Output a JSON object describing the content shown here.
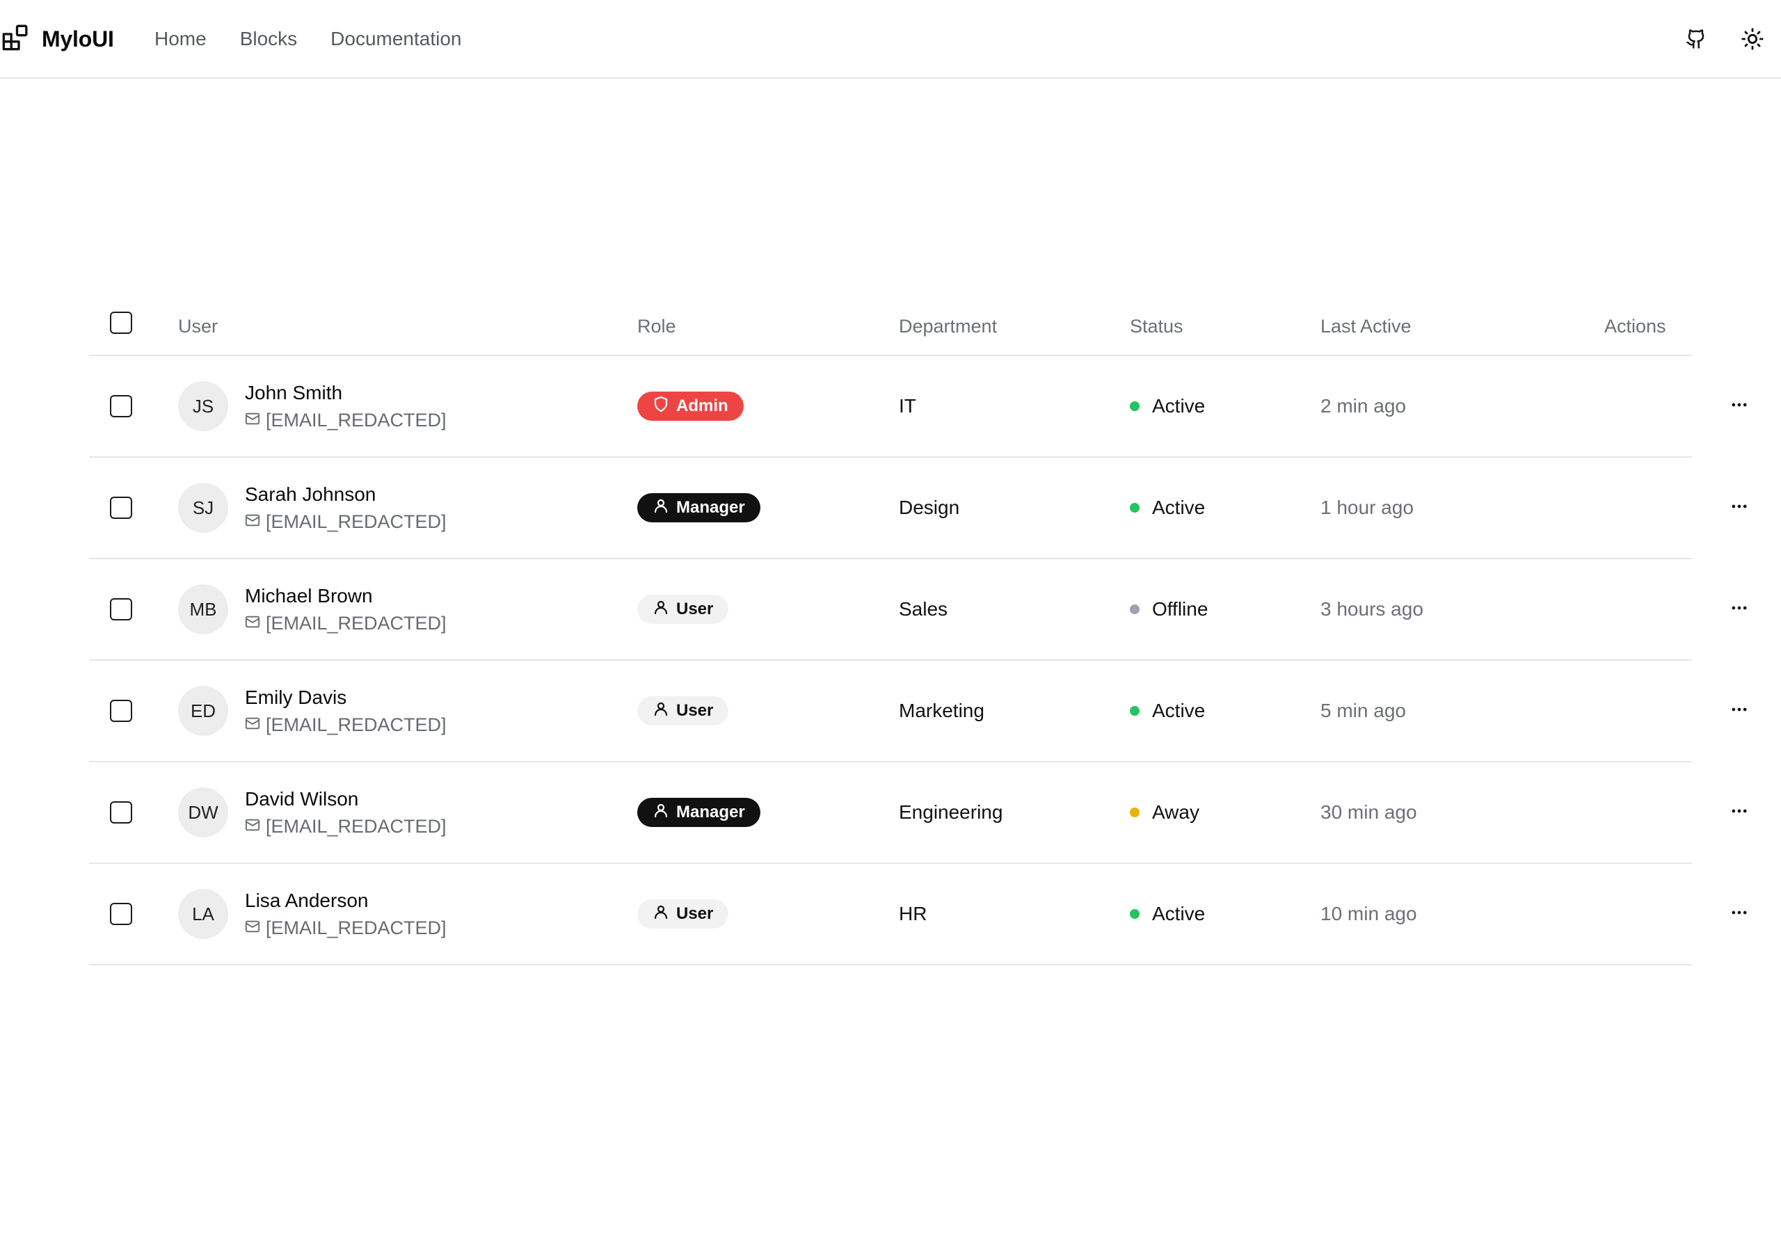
{
  "navbar": {
    "brand": "MyloUI",
    "links": [
      "Home",
      "Blocks",
      "Documentation"
    ],
    "icons": [
      "github-icon",
      "sun-icon"
    ]
  },
  "table": {
    "headers": {
      "user": "User",
      "role": "Role",
      "department": "Department",
      "status": "Status",
      "last_active": "Last Active",
      "actions": "Actions"
    },
    "rows": [
      {
        "initials": "JS",
        "name": "John Smith",
        "email": "[EMAIL_REDACTED]",
        "role": "Admin",
        "department": "IT",
        "status": "Active",
        "last_active": "2 min ago"
      },
      {
        "initials": "SJ",
        "name": "Sarah Johnson",
        "email": "[EMAIL_REDACTED]",
        "role": "Manager",
        "department": "Design",
        "status": "Active",
        "last_active": "1 hour ago"
      },
      {
        "initials": "MB",
        "name": "Michael Brown",
        "email": "[EMAIL_REDACTED]",
        "role": "User",
        "department": "Sales",
        "status": "Offline",
        "last_active": "3 hours ago"
      },
      {
        "initials": "ED",
        "name": "Emily Davis",
        "email": "[EMAIL_REDACTED]",
        "role": "User",
        "department": "Marketing",
        "status": "Active",
        "last_active": "5 min ago"
      },
      {
        "initials": "DW",
        "name": "David Wilson",
        "email": "[EMAIL_REDACTED]",
        "role": "Manager",
        "department": "Engineering",
        "status": "Away",
        "last_active": "30 min ago"
      },
      {
        "initials": "LA",
        "name": "Lisa Anderson",
        "email": "[EMAIL_REDACTED]",
        "role": "User",
        "department": "HR",
        "status": "Active",
        "last_active": "10 min ago"
      }
    ]
  },
  "colors": {
    "admin_badge": "#ef4444",
    "manager_badge": "#111111",
    "user_badge": "#f2f2f2",
    "status_active": "#22c55e",
    "status_offline": "#9ca3af",
    "status_away": "#eab308"
  }
}
